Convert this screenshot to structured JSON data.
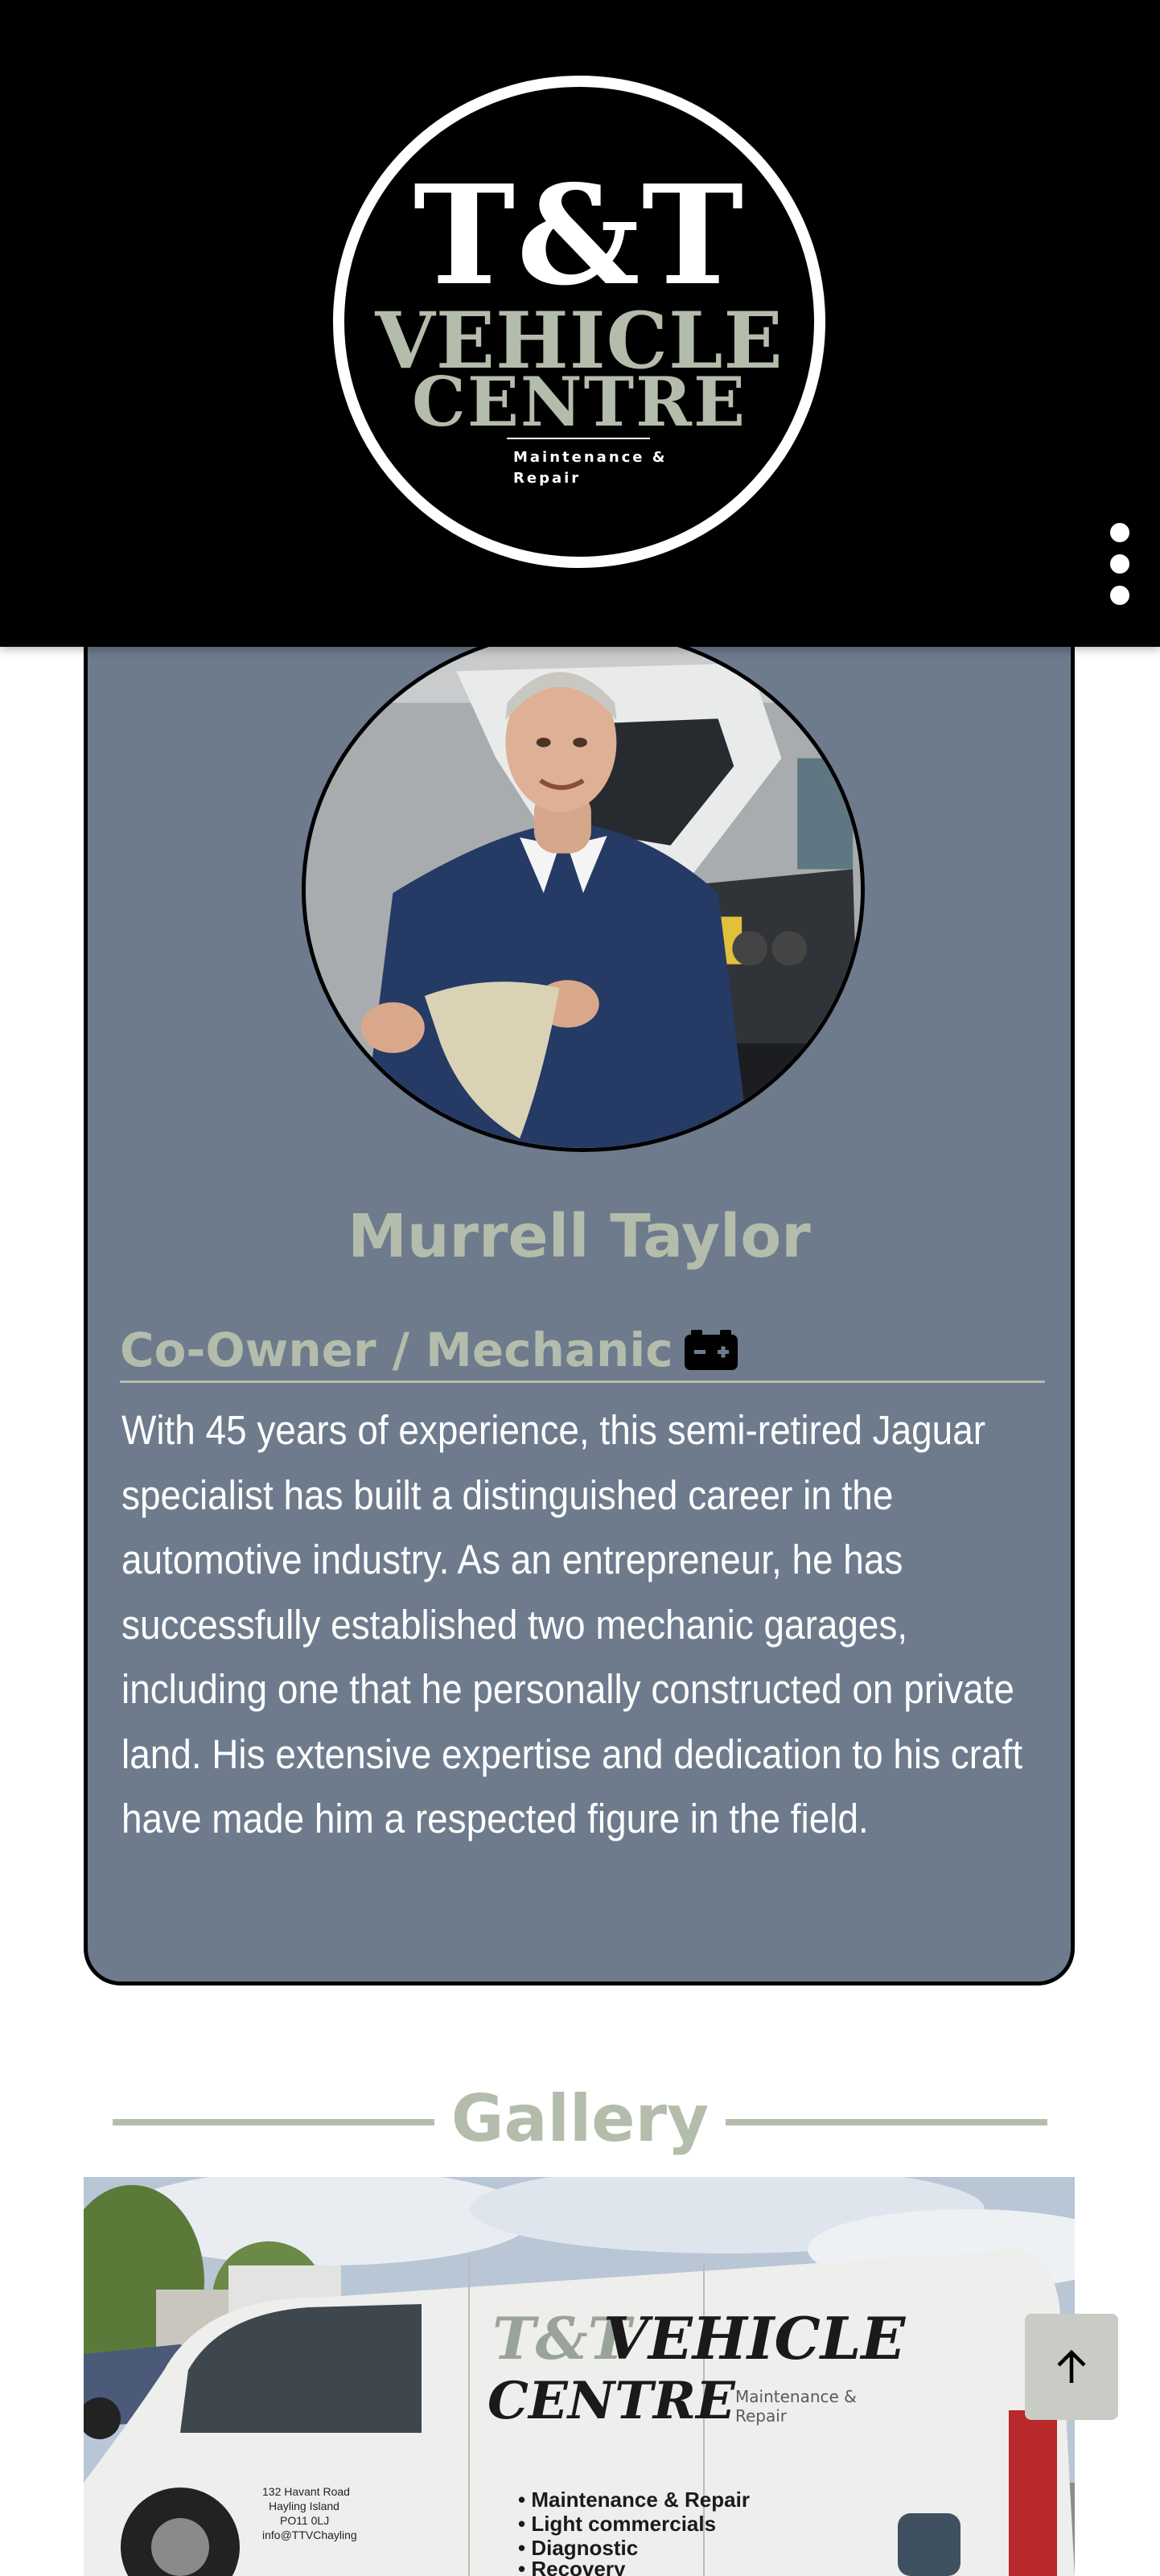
{
  "header": {
    "logo": {
      "line1": "T&T",
      "line2": "VEHICLE",
      "line3": "CENTRE",
      "tagline_1": "Maintenance &",
      "tagline_2": "Repair"
    },
    "menu_icon": "vertical-ellipsis-icon"
  },
  "profile": {
    "name": "Murrell Taylor",
    "role": "Co-Owner / Mechanic",
    "role_icon": "car-battery-icon",
    "bio": "With 45 years of experience, this semi-retired Jaguar specialist has built a distinguished career in the automotive industry. As an entrepreneur, he has successfully established two mechanic garages, including one that he personally constructed on private land. His extensive expertise and dedication to his craft have made him a respected figure in the field."
  },
  "gallery": {
    "title": "Gallery",
    "van": {
      "brand_1": "T&T",
      "brand_2": "VEHICLE",
      "brand_3": "CENTRE",
      "brand_tag_1": "Maintenance &",
      "brand_tag_2": "Repair",
      "address_1": "132 Havant Road",
      "address_2": "Hayling Island",
      "address_3": "PO11 0LJ",
      "address_4": "info@TTVChayling",
      "service_1": "• Maintenance & Repair",
      "service_2": "• Light commercials",
      "service_3": "• Diagnostic",
      "service_4": "• Recovery"
    }
  },
  "back_to_top_icon": "arrow-up-icon",
  "colors": {
    "header_bg": "#000000",
    "accent_sage": "#b4bcab",
    "card_bg": "#6d7b8d",
    "text_white": "#ffffff"
  }
}
